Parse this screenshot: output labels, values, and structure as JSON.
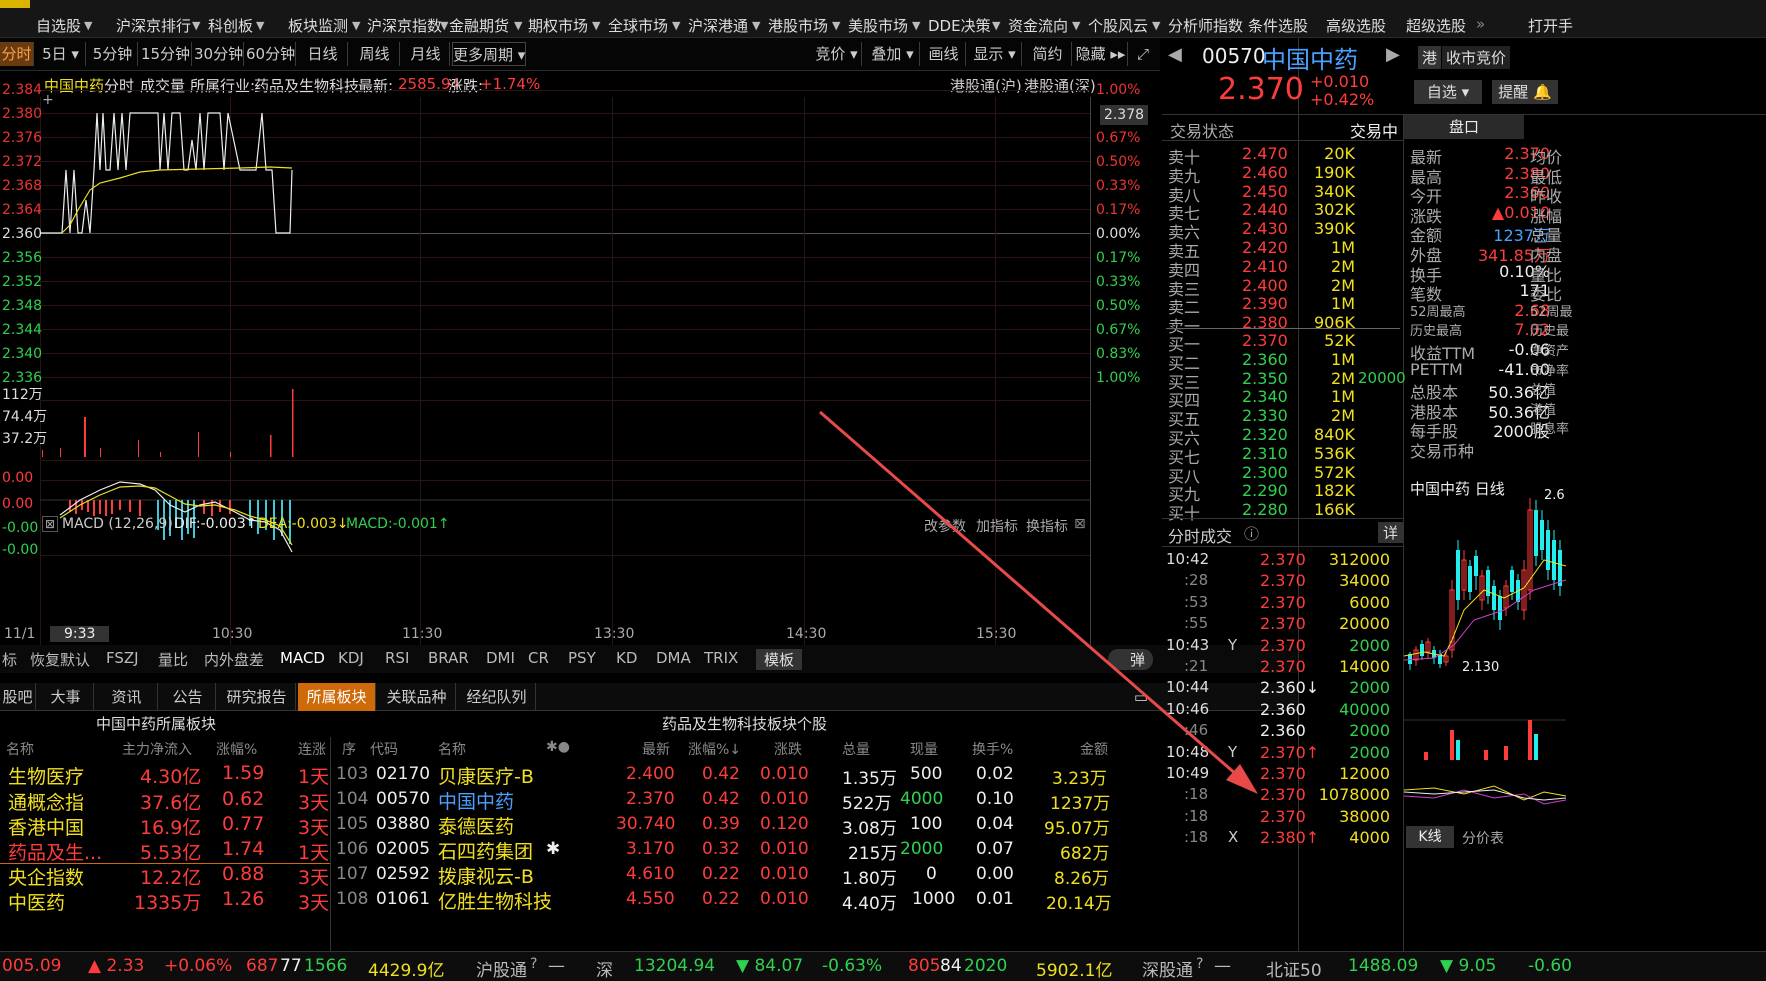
{
  "nav": [
    "自选股",
    "沪深京排行",
    "科创板",
    "板块监测",
    "沪深京指数",
    "金融期货",
    "期权市场",
    "全球市场",
    "沪深港通",
    "港股市场",
    "美股市场",
    "DDE决策",
    "资金流向",
    "个股风云",
    "分析师指数",
    "条件选股",
    "高级选股",
    "超级选股",
    "»",
    "打开手"
  ],
  "periods": [
    "分时",
    "5日",
    "5分钟",
    "15分钟",
    "30分钟",
    "60分钟",
    "日线",
    "周线",
    "月线",
    "更多周期",
    "竞价",
    "叠加",
    "画线",
    "显示",
    "简约",
    "隐藏"
  ],
  "info": {
    "name": "中国中药",
    "mode": "分时",
    "vol": "成交量",
    "ind_label": "所属行业:",
    "ind": "药品及生物科技",
    "latest_label": "最新:",
    "latest": "2585.94",
    "chg_label": "涨跌:",
    "chg": "+1.74%",
    "hk1": "港股通(沪)",
    "hk2": "港股通(深)"
  },
  "yleft": [
    "2.384",
    "2.380",
    "2.376",
    "2.372",
    "2.368",
    "2.364",
    "2.360",
    "2.356",
    "2.352",
    "2.348",
    "2.344",
    "2.340",
    "2.336"
  ],
  "yright": [
    "1.00%",
    "0.67%",
    "0.50%",
    "0.33%",
    "0.17%",
    "0.00%",
    "0.17%",
    "0.33%",
    "0.50%",
    "0.67%",
    "0.83%",
    "1.00%"
  ],
  "cross": "2.378",
  "vol_labels": [
    "112万",
    "74.4万",
    "37.2万"
  ],
  "macd": {
    "name": "MACD (12,26,9)",
    "dif": "DIF:-0.003↑",
    "dea": "DEA:-0.003↓",
    "macd": "MACD:-0.001↑",
    "p1": "改参数",
    "p2": "加指标",
    "p3": "换指标",
    "y": [
      "0.00",
      "0.00",
      "-0.00",
      "-0.00"
    ]
  },
  "times": [
    "11/1",
    "9:33",
    "10:30",
    "11:30",
    "13:30",
    "14:30",
    "15:30"
  ],
  "ind_tabs": [
    "标",
    "恢复默认",
    "FSZJ",
    "量比",
    "内外盘差",
    "MACD",
    "KDJ",
    "RSI",
    "BRAR",
    "DMI",
    "CR",
    "PSY",
    "KD",
    "DMA",
    "TRIX",
    "模板",
    "弹"
  ],
  "btabs": [
    "股吧",
    "大事",
    "资讯",
    "公告",
    "研究报告",
    "所属板块",
    "关联品种",
    "经纪队列"
  ],
  "left_title": "中国中药所属板块",
  "right_title": "药品及生物科技板块个股",
  "left_hdr": [
    "名称",
    "主力净流入",
    "涨幅%",
    "连涨"
  ],
  "left_rows": [
    [
      "生物医疗",
      "4.30亿",
      "1.59",
      "1天"
    ],
    [
      "通概念指",
      "37.6亿",
      "0.62",
      "3天"
    ],
    [
      "香港中国",
      "16.9亿",
      "0.77",
      "3天"
    ],
    [
      "药品及生...",
      "5.53亿",
      "1.74",
      "1天"
    ],
    [
      "央企指数",
      "12.2亿",
      "0.88",
      "3天"
    ],
    [
      "中医药",
      "1335万",
      "1.26",
      "3天"
    ]
  ],
  "right_hdr": [
    "序",
    "代码",
    "名称",
    "✱●",
    "最新",
    "涨幅%↓",
    "涨跌",
    "总量",
    "现量",
    "换手%",
    "金额"
  ],
  "right_rows": [
    [
      "103",
      "02170",
      "贝康医疗-B",
      "",
      "2.400",
      "0.42",
      "0.010",
      "1.35万",
      "500",
      "0.02",
      "3.23万"
    ],
    [
      "104",
      "00570",
      "中国中药",
      "",
      "2.370",
      "0.42",
      "0.010",
      "522万",
      "4000",
      "0.10",
      "1237万"
    ],
    [
      "105",
      "03880",
      "泰德医药",
      "",
      "30.740",
      "0.39",
      "0.120",
      "3.08万",
      "100",
      "0.04",
      "95.07万"
    ],
    [
      "106",
      "02005",
      "石四药集团",
      "✱",
      "3.170",
      "0.32",
      "0.010",
      "215万",
      "2000",
      "0.07",
      "682万"
    ],
    [
      "107",
      "02592",
      "拨康视云-B",
      "",
      "4.610",
      "0.22",
      "0.010",
      "1.80万",
      "0",
      "0.00",
      "8.26万"
    ],
    [
      "108",
      "01061",
      "亿胜生物科技",
      "",
      "4.550",
      "0.22",
      "0.010",
      "4.40万",
      "1000",
      "0.01",
      "20.14万"
    ]
  ],
  "status": {
    "a": "005.09",
    "b": "▲ 2.33",
    "c": "+0.06%",
    "d": "687",
    "e": "77",
    "f": "1566",
    "g": "4429.9亿",
    "h": "沪股通",
    "i": "—",
    "j": "深",
    "k": "13204.94",
    "l": "▼ 84.07",
    "m": "-0.63%",
    "n": "805",
    "o": "84",
    "p": "2020",
    "q": "5902.1亿",
    "r": "深股通",
    "s": "—",
    "t": "北证50",
    "u": "1488.09",
    "v": "▼ 9.05",
    "w": "-0.60"
  },
  "quote": {
    "code": "00570",
    "name": "中国中药",
    "price": "2.370",
    "chg": "+0.010",
    "pct": "+0.42%",
    "b1": "港",
    "b2": "收市竞价",
    "b3": "自选",
    "b4": "提醒",
    "state_label": "交易状态",
    "state": "交易中",
    "tab": "盘口"
  },
  "sell": [
    [
      "卖十",
      "2.470",
      "20K"
    ],
    [
      "卖九",
      "2.460",
      "190K"
    ],
    [
      "卖八",
      "2.450",
      "340K"
    ],
    [
      "卖七",
      "2.440",
      "302K"
    ],
    [
      "卖六",
      "2.430",
      "390K"
    ],
    [
      "卖五",
      "2.420",
      "1M"
    ],
    [
      "卖四",
      "2.410",
      "2M"
    ],
    [
      "卖三",
      "2.400",
      "2M"
    ],
    [
      "卖二",
      "2.390",
      "1M"
    ],
    [
      "卖一",
      "2.380",
      "906K"
    ]
  ],
  "buy": [
    [
      "买一",
      "2.370",
      "52K",
      ""
    ],
    [
      "买二",
      "2.360",
      "1M",
      ""
    ],
    [
      "买三",
      "2.350",
      "2M",
      "20000"
    ],
    [
      "买四",
      "2.340",
      "1M",
      ""
    ],
    [
      "买五",
      "2.330",
      "2M",
      ""
    ],
    [
      "买六",
      "2.320",
      "840K",
      ""
    ],
    [
      "买七",
      "2.310",
      "536K",
      ""
    ],
    [
      "买八",
      "2.300",
      "572K",
      ""
    ],
    [
      "买九",
      "2.290",
      "182K",
      ""
    ],
    [
      "买十",
      "2.280",
      "166K",
      ""
    ]
  ],
  "pk": [
    [
      "最新",
      "2.370",
      "均价"
    ],
    [
      "最高",
      "2.380",
      "最低"
    ],
    [
      "今开",
      "2.360",
      "昨收"
    ],
    [
      "涨跌",
      "▲0.010",
      "涨幅"
    ],
    [
      "金额",
      "1237万",
      "总量"
    ],
    [
      "外盘",
      "341.85万",
      "内盘"
    ],
    [
      "换手",
      "0.10%",
      "量比"
    ],
    [
      "笔数",
      "171",
      "委比"
    ],
    [
      "52周最高",
      "2.68",
      "52周最"
    ],
    [
      "历史最高",
      "7.02",
      "历史最"
    ],
    [
      "收益TTM",
      "-0.06",
      "净资产"
    ],
    [
      "PETTM",
      "-41.00",
      "市净率"
    ],
    [
      "总股本",
      "50.36亿",
      "总值"
    ],
    [
      "港股本",
      "50.36亿",
      "港值"
    ],
    [
      "每手股",
      "2000股",
      "股息率"
    ],
    [
      "交易币种",
      "",
      ""
    ]
  ],
  "ticks_title": "分时成交",
  "ticks_more": "详",
  "ticks": [
    [
      "10:42",
      "",
      "2.370",
      "312000"
    ],
    [
      ":28",
      "",
      "2.370",
      "34000"
    ],
    [
      ":53",
      "",
      "2.370",
      "6000"
    ],
    [
      ":55",
      "",
      "2.370",
      "20000"
    ],
    [
      "10:43",
      "Y",
      "2.370",
      "2000"
    ],
    [
      ":21",
      "",
      "2.370",
      "14000"
    ],
    [
      "10:44",
      "",
      "2.360↓",
      "2000"
    ],
    [
      "10:46",
      "",
      "2.360",
      "40000"
    ],
    [
      ":46",
      "",
      "2.360",
      "2000"
    ],
    [
      "10:48",
      "Y",
      "2.370↑",
      "2000"
    ],
    [
      "10:49",
      "",
      "2.370",
      "12000"
    ],
    [
      ":18",
      "",
      "2.370",
      "1078000"
    ],
    [
      ":18",
      "",
      "2.370",
      "38000"
    ],
    [
      ":18",
      "X",
      "2.380↑",
      "4000"
    ]
  ],
  "kline": {
    "title": "中国中药 日线",
    "hi": "2.6",
    "lo": "2.130",
    "tab1": "K线",
    "tab2": "分价表"
  }
}
